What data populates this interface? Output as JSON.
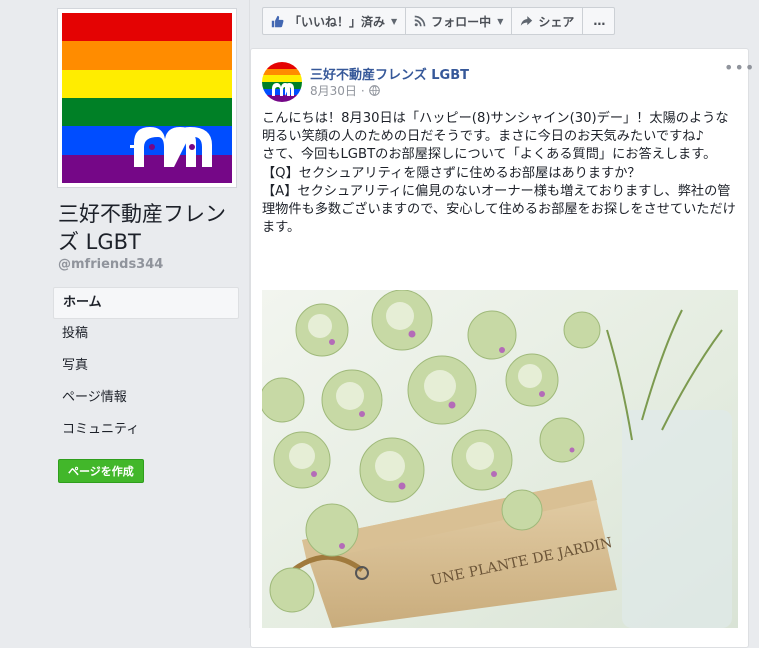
{
  "page": {
    "name": "三好不動産フレンズ LGBT",
    "handle": "@mfriends344"
  },
  "colors": {
    "rainbow": [
      "#e40303",
      "#ff8c00",
      "#ffed00",
      "#008026",
      "#004dff",
      "#750787"
    ],
    "link": "#365899",
    "create_button": "#42b72a"
  },
  "nav": {
    "items": [
      {
        "label": "ホーム",
        "active": true
      },
      {
        "label": "投稿"
      },
      {
        "label": "写真"
      },
      {
        "label": "ページ情報"
      },
      {
        "label": "コミュニティ"
      }
    ]
  },
  "create_page_label": "ページを作成",
  "actions": {
    "like_label": "「いいね！」済み",
    "follow_label": "フォロー中",
    "share_label": "シェア",
    "more_label": "…",
    "icons": [
      "thumbs-up-icon",
      "rss-icon",
      "share-arrow-icon"
    ]
  },
  "post": {
    "author": "三好不動産フレンズ LGBT",
    "date": "8月30日",
    "separator": "·",
    "privacy_icon": "globe-icon",
    "more_label": "•••",
    "body": "こんにちは！8月30日は「ハッピー(8)サンシャイン(30)デー」！太陽のような明るい笑顔の人のための日だそうです。まさに今日のお天気みたいですね♪\nさて、今回もLGBTのお部屋探しについて「よくある質問」にお答えします。\n【Q】セクシュアリティを隠さずに住めるお部屋はありますか？\n【A】セクシュアリティに偏見のないオーナー様も増えておりますし、弊社の管理物件も多数ございますので、安心して住めるお部屋をお探しをさせていただけます。",
    "image_caption": "UNE PLANTE DE JARDIN"
  }
}
